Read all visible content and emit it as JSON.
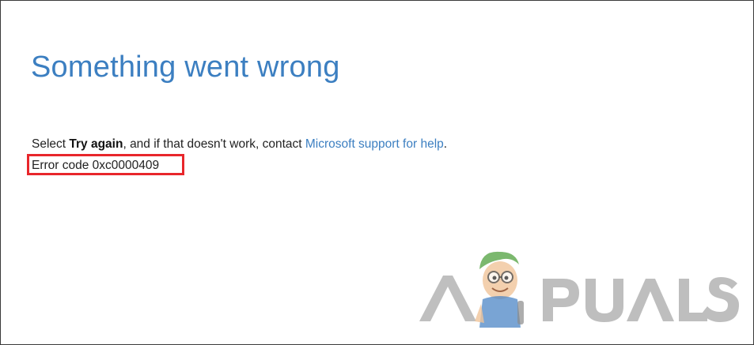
{
  "page": {
    "title": "Something went wrong",
    "message": {
      "prefix": "Select ",
      "emphasis": "Try again",
      "middle": ", and if that doesn't work, contact ",
      "link": "Microsoft support for help",
      "suffix": "."
    },
    "error_code": "Error code 0xc0000409"
  },
  "watermark": {
    "text": "APPUALS"
  },
  "colors": {
    "title": "#3c7fc1",
    "link": "#3c7fc1",
    "highlight": "#e8262b",
    "text": "#222222"
  }
}
